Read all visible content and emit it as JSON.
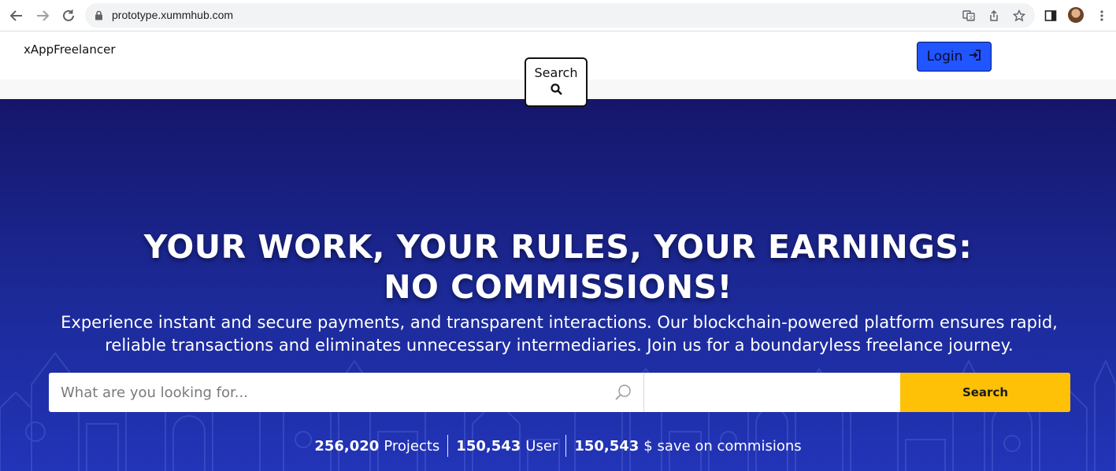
{
  "browser": {
    "url": "prototype.xummhub.com",
    "icons": [
      "back-arrow-icon",
      "forward-arrow-icon",
      "reload-icon",
      "lock-icon",
      "translate-icon",
      "share-icon",
      "star-icon",
      "side-panel-icon",
      "profile-avatar",
      "kebab-menu-icon"
    ]
  },
  "header": {
    "logo": "xAppFreelancer",
    "login_label": "Login",
    "search_label": "Search"
  },
  "hero": {
    "headline_line1": "YOUR WORK, YOUR RULES, YOUR EARNINGS:",
    "headline_line2": "NO COMMISSIONS!",
    "subtitle": "Experience instant and secure payments, and transparent interactions. Our blockchain-powered platform ensures rapid, reliable transactions and eliminates unnecessary intermediaries. Join us for a boundaryless freelance journey.",
    "search_placeholder": "What are you looking for...",
    "location_value": "",
    "search_button": "Search"
  },
  "stats": [
    {
      "value": "256,020",
      "label": "Projects"
    },
    {
      "value": "150,543",
      "label": "User"
    },
    {
      "value": "150,543",
      "label": "$ save on commisions"
    }
  ],
  "colors": {
    "hero_top": "#15166a",
    "hero_bottom": "#2234b8",
    "login_bg": "#2155ff",
    "search_button_bg": "#ffc107"
  }
}
